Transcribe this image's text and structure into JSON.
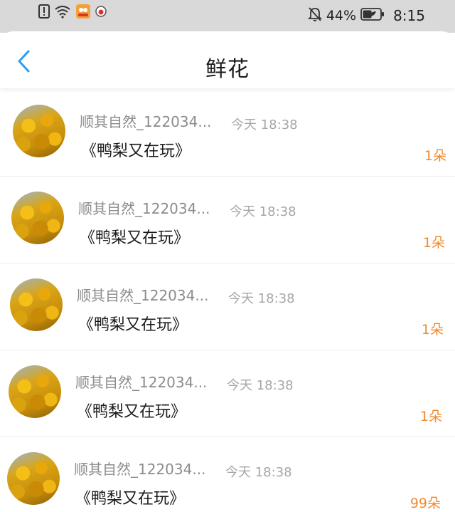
{
  "status_bar": {
    "battery_percent": "44%",
    "time": "8:15",
    "icons": [
      "alert-icon",
      "wifi-icon",
      "app-notification-icon",
      "app-notification-icon",
      "mute-bell-icon",
      "battery-icon"
    ]
  },
  "header": {
    "title": "鲜花",
    "back_icon": "chevron-left-icon"
  },
  "colors": {
    "accent": "#2f9bf0",
    "count": "#ef8a2f",
    "sender": "#8c8c8c",
    "time": "#a6a6a6",
    "title": "#1a1a1a"
  },
  "entries": [
    {
      "sender": "顺其自然_122034...",
      "time": "今天 18:38",
      "title": "《鸭梨又在玩》",
      "count": "1朵"
    },
    {
      "sender": "顺其自然_122034...",
      "time": "今天 18:38",
      "title": "《鸭梨又在玩》",
      "count": "1朵"
    },
    {
      "sender": "顺其自然_122034...",
      "time": "今天 18:38",
      "title": "《鸭梨又在玩》",
      "count": "1朵"
    },
    {
      "sender": "顺其自然_122034...",
      "time": "今天 18:38",
      "title": "《鸭梨又在玩》",
      "count": "1朵"
    },
    {
      "sender": "顺其自然_122034...",
      "time": "今天 18:38",
      "title": "《鸭梨又在玩》",
      "count": "99朵"
    }
  ]
}
